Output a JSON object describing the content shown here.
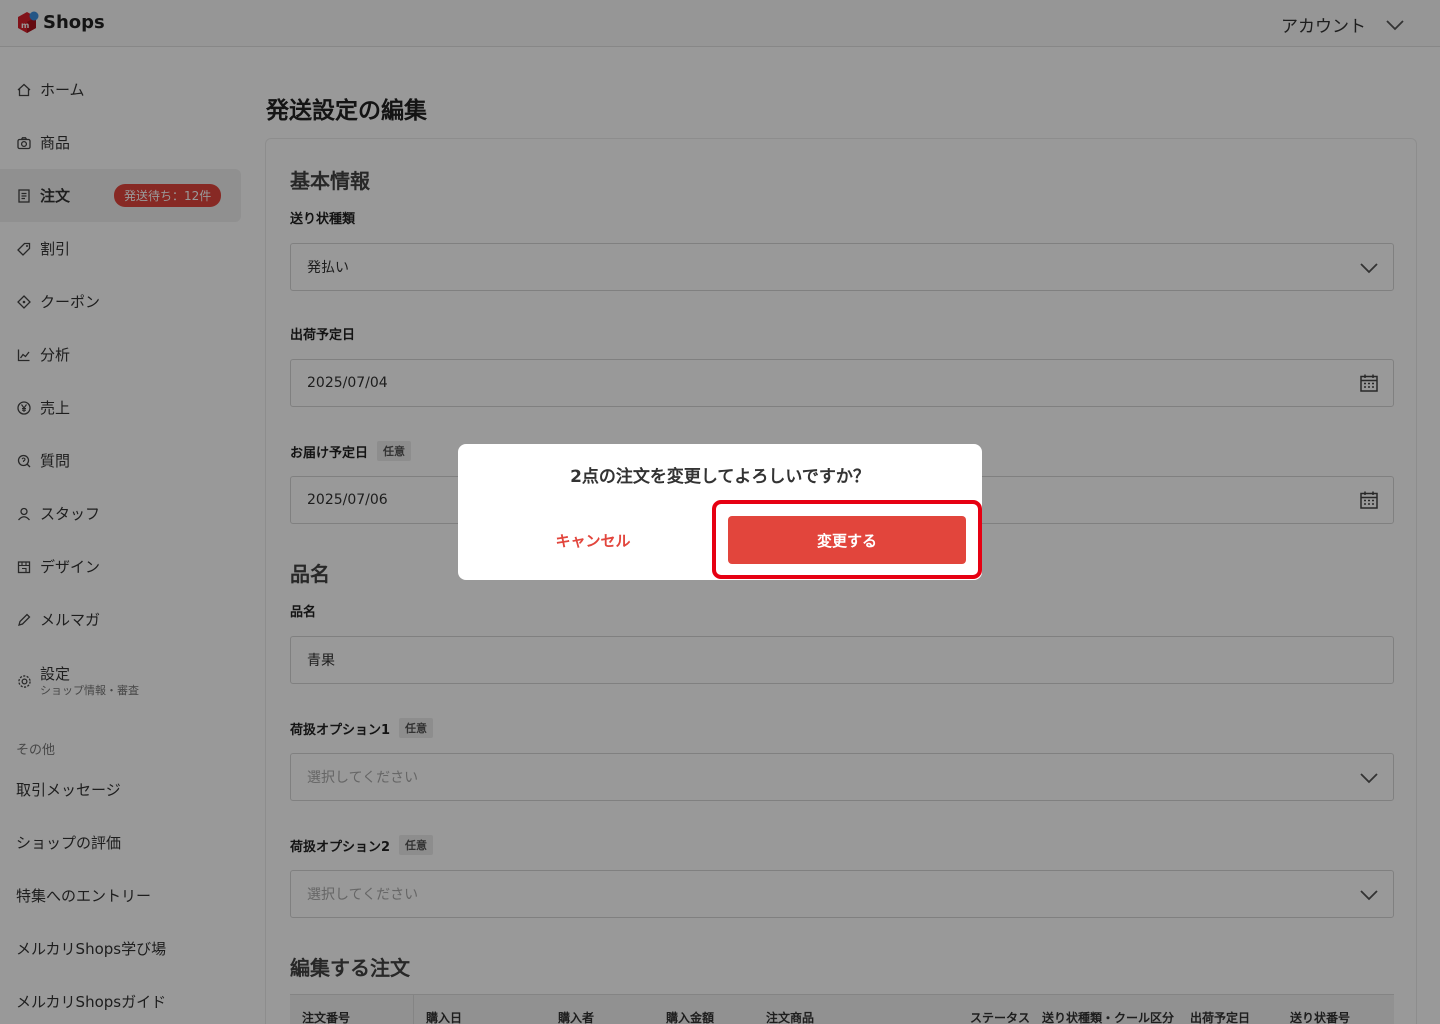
{
  "header": {
    "logo_text": "Shops",
    "account_label": "アカウント"
  },
  "sidebar": {
    "items": [
      {
        "label": "ホーム",
        "icon": "home-icon"
      },
      {
        "label": "商品",
        "icon": "camera-icon"
      },
      {
        "label": "注文",
        "icon": "document-icon",
        "badge": "発送待ち：12件",
        "active": true
      },
      {
        "label": "割引",
        "icon": "tag-icon"
      },
      {
        "label": "クーポン",
        "icon": "coupon-icon"
      },
      {
        "label": "分析",
        "icon": "chart-icon"
      },
      {
        "label": "売上",
        "icon": "yen-icon"
      },
      {
        "label": "質問",
        "icon": "question-icon"
      },
      {
        "label": "スタッフ",
        "icon": "person-icon"
      },
      {
        "label": "デザイン",
        "icon": "store-icon"
      },
      {
        "label": "メルマガ",
        "icon": "pen-icon"
      },
      {
        "label": "設定",
        "sublabel": "ショップ情報・審査",
        "icon": "gear-icon"
      }
    ],
    "other_label": "その他",
    "other_items": [
      "取引メッセージ",
      "ショップの評価",
      "特集へのエントリー",
      "メルカリShops学び場",
      "メルカリShopsガイド"
    ]
  },
  "main": {
    "page_title": "発送設定の編集",
    "basic": {
      "title": "基本情報",
      "shipping_type_label": "送り状種類",
      "shipping_type_value": "発払い",
      "ship_date_label": "出荷予定日",
      "ship_date_value": "2025/07/04",
      "delivery_date_label": "お届け予定日",
      "delivery_date_value": "2025/07/06",
      "optional_tag": "任意"
    },
    "item": {
      "title": "品名",
      "name_label": "品名",
      "name_value": "青果",
      "handling1_label": "荷扱オプション1",
      "handling2_label": "荷扱オプション2",
      "select_placeholder": "選択してください"
    },
    "orders": {
      "title": "編集する注文",
      "columns": [
        "注文番号",
        "購入日",
        "購入者",
        "購入金額",
        "注文商品",
        "ステータス",
        "送り状種類・クール区分",
        "出荷予定日",
        "送り状番号"
      ]
    }
  },
  "modal": {
    "message": "2点の注文を変更してよろしいですか？",
    "cancel_label": "キャンセル",
    "confirm_label": "変更する"
  },
  "colors": {
    "accent": "#e2453c",
    "highlight": "#e60012"
  }
}
